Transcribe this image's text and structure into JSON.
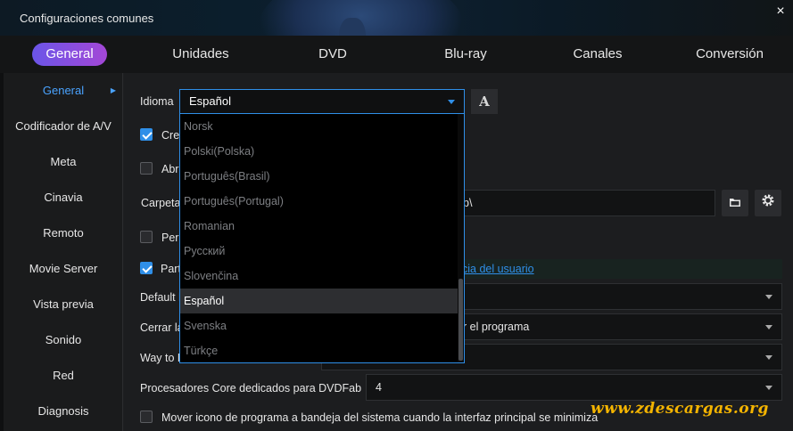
{
  "window": {
    "title": "Configuraciones comunes",
    "close_symbol": "×"
  },
  "tabs": [
    {
      "label": "General",
      "active": true
    },
    {
      "label": "Unidades"
    },
    {
      "label": "DVD"
    },
    {
      "label": "Blu-ray"
    },
    {
      "label": "Canales"
    },
    {
      "label": "Conversión"
    }
  ],
  "sidebar": {
    "caret_symbol": "▶",
    "items": [
      {
        "label": "General",
        "active": true
      },
      {
        "label": "Codificador de A/V"
      },
      {
        "label": "Meta"
      },
      {
        "label": "Cinavia"
      },
      {
        "label": "Remoto"
      },
      {
        "label": "Movie Server"
      },
      {
        "label": "Vista previa"
      },
      {
        "label": "Sonido"
      },
      {
        "label": "Red"
      },
      {
        "label": "Diagnosis"
      }
    ]
  },
  "general": {
    "language_label": "Idioma",
    "language_value": "Español",
    "font_button_glyph": "A",
    "row_cre": "Cre",
    "row_abri": "Abri",
    "folder_label": "Carpeta",
    "folder_value_tail": "p\\",
    "row_per": "Per",
    "row_part": "Part",
    "user_experience_link": "cia del usuario",
    "default_label": "Default l",
    "close_label": "Cerrar la",
    "close_value_tail": "r el programa",
    "way_label": "Way to D",
    "cores_label": "Procesadores Core dedicados para DVDFab",
    "cores_value": "4",
    "tray_label": "Mover icono de programa a bandeja del sistema cuando la interfaz principal se minimiza",
    "folder_icon": "folder-icon",
    "gear_icon": "gear-icon"
  },
  "checkbox_states": {
    "cre": true,
    "abri": false,
    "per": false,
    "part": true,
    "tray": false
  },
  "language_options": [
    {
      "label": "Norsk"
    },
    {
      "label": "Polski(Polska)"
    },
    {
      "label": "Português(Brasil)"
    },
    {
      "label": "Português(Portugal)"
    },
    {
      "label": "Romanian"
    },
    {
      "label": "Русский"
    },
    {
      "label": "Slovenčina"
    },
    {
      "label": "Español",
      "selected": true
    },
    {
      "label": "Svenska"
    },
    {
      "label": "Türkçe"
    }
  ],
  "watermark": "www.zdescargas.org",
  "colors": {
    "accent": "#2f8fe8",
    "tab_gradient_start": "#6b55e8",
    "tab_gradient_end": "#a347d6",
    "watermark": "#f4b400"
  }
}
